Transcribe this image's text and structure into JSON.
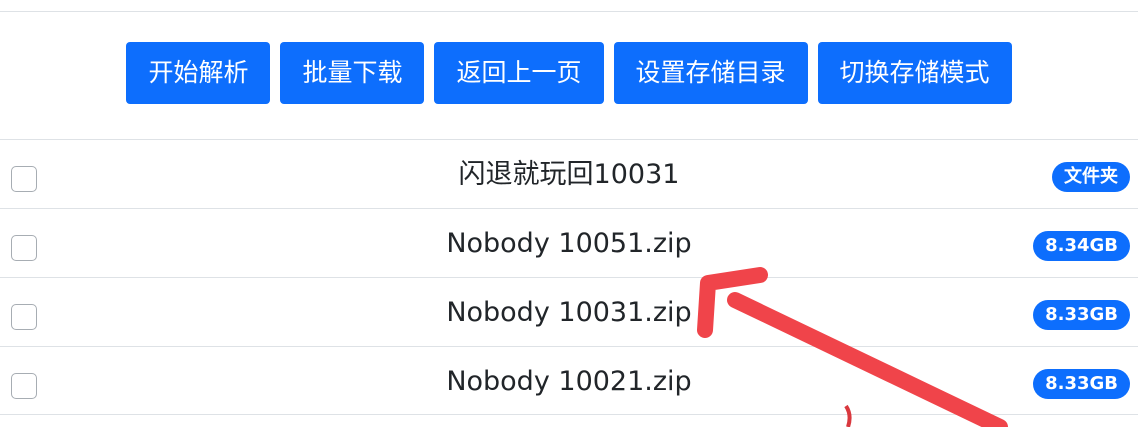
{
  "toolbar": {
    "buttons": [
      {
        "label": "开始解析"
      },
      {
        "label": "批量下载"
      },
      {
        "label": "返回上一页"
      },
      {
        "label": "设置存储目录"
      },
      {
        "label": "切换存储模式"
      }
    ]
  },
  "files": [
    {
      "name": "闪退就玩回10031",
      "badge": "文件夹",
      "checked": false
    },
    {
      "name": "Nobody 10051.zip",
      "badge": "8.34GB",
      "checked": false
    },
    {
      "name": "Nobody 10031.zip",
      "badge": "8.33GB",
      "checked": false
    },
    {
      "name": "Nobody 10021.zip",
      "badge": "8.33GB",
      "checked": false
    }
  ],
  "colors": {
    "primary": "#0d6efd",
    "annotation_arrow": "#f0444a"
  },
  "icons": {
    "annotation": "red-arrow-icon"
  }
}
